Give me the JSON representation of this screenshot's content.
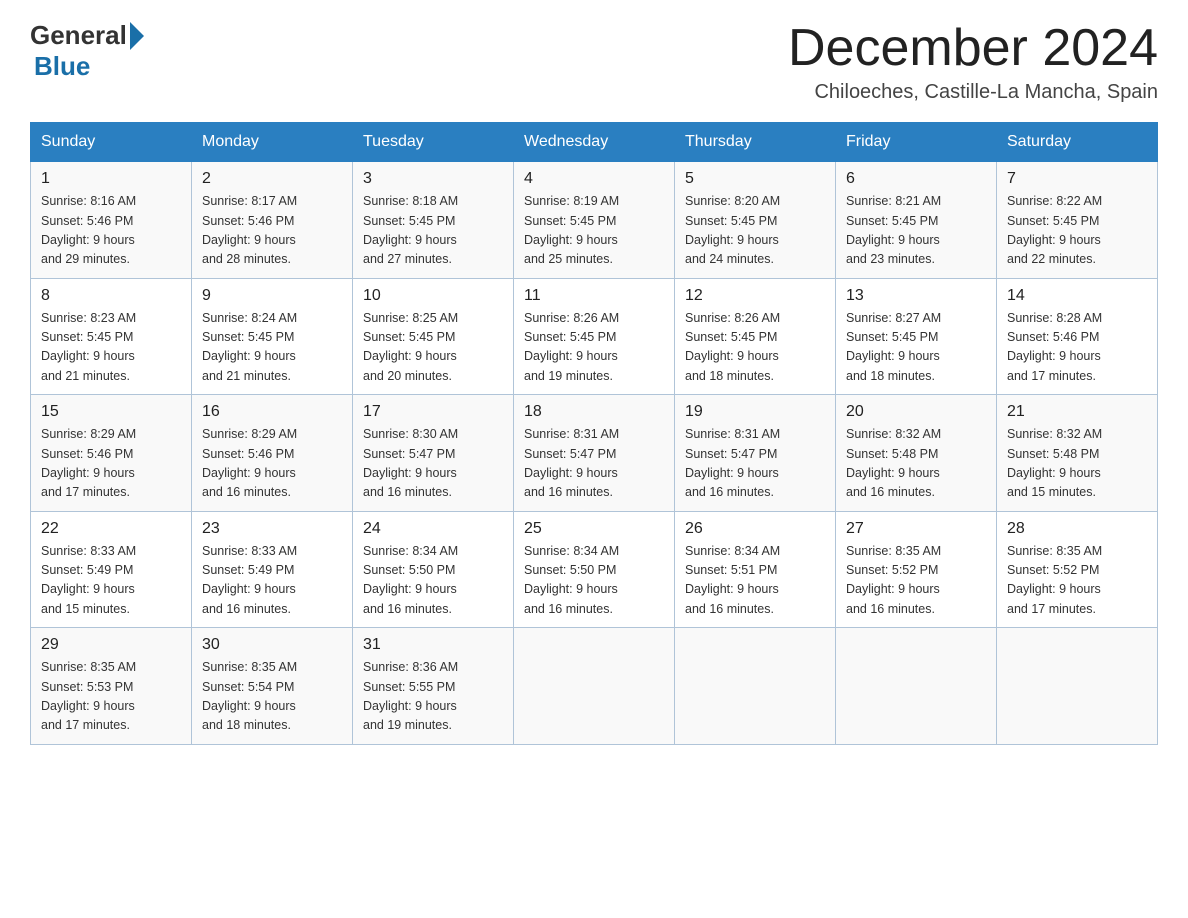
{
  "header": {
    "logo_general": "General",
    "logo_blue": "Blue",
    "month_title": "December 2024",
    "location": "Chiloeches, Castille-La Mancha, Spain"
  },
  "days_of_week": [
    "Sunday",
    "Monday",
    "Tuesday",
    "Wednesday",
    "Thursday",
    "Friday",
    "Saturday"
  ],
  "weeks": [
    [
      {
        "day": "1",
        "sunrise": "8:16 AM",
        "sunset": "5:46 PM",
        "daylight": "9 hours and 29 minutes."
      },
      {
        "day": "2",
        "sunrise": "8:17 AM",
        "sunset": "5:46 PM",
        "daylight": "9 hours and 28 minutes."
      },
      {
        "day": "3",
        "sunrise": "8:18 AM",
        "sunset": "5:45 PM",
        "daylight": "9 hours and 27 minutes."
      },
      {
        "day": "4",
        "sunrise": "8:19 AM",
        "sunset": "5:45 PM",
        "daylight": "9 hours and 25 minutes."
      },
      {
        "day": "5",
        "sunrise": "8:20 AM",
        "sunset": "5:45 PM",
        "daylight": "9 hours and 24 minutes."
      },
      {
        "day": "6",
        "sunrise": "8:21 AM",
        "sunset": "5:45 PM",
        "daylight": "9 hours and 23 minutes."
      },
      {
        "day": "7",
        "sunrise": "8:22 AM",
        "sunset": "5:45 PM",
        "daylight": "9 hours and 22 minutes."
      }
    ],
    [
      {
        "day": "8",
        "sunrise": "8:23 AM",
        "sunset": "5:45 PM",
        "daylight": "9 hours and 21 minutes."
      },
      {
        "day": "9",
        "sunrise": "8:24 AM",
        "sunset": "5:45 PM",
        "daylight": "9 hours and 21 minutes."
      },
      {
        "day": "10",
        "sunrise": "8:25 AM",
        "sunset": "5:45 PM",
        "daylight": "9 hours and 20 minutes."
      },
      {
        "day": "11",
        "sunrise": "8:26 AM",
        "sunset": "5:45 PM",
        "daylight": "9 hours and 19 minutes."
      },
      {
        "day": "12",
        "sunrise": "8:26 AM",
        "sunset": "5:45 PM",
        "daylight": "9 hours and 18 minutes."
      },
      {
        "day": "13",
        "sunrise": "8:27 AM",
        "sunset": "5:45 PM",
        "daylight": "9 hours and 18 minutes."
      },
      {
        "day": "14",
        "sunrise": "8:28 AM",
        "sunset": "5:46 PM",
        "daylight": "9 hours and 17 minutes."
      }
    ],
    [
      {
        "day": "15",
        "sunrise": "8:29 AM",
        "sunset": "5:46 PM",
        "daylight": "9 hours and 17 minutes."
      },
      {
        "day": "16",
        "sunrise": "8:29 AM",
        "sunset": "5:46 PM",
        "daylight": "9 hours and 16 minutes."
      },
      {
        "day": "17",
        "sunrise": "8:30 AM",
        "sunset": "5:47 PM",
        "daylight": "9 hours and 16 minutes."
      },
      {
        "day": "18",
        "sunrise": "8:31 AM",
        "sunset": "5:47 PM",
        "daylight": "9 hours and 16 minutes."
      },
      {
        "day": "19",
        "sunrise": "8:31 AM",
        "sunset": "5:47 PM",
        "daylight": "9 hours and 16 minutes."
      },
      {
        "day": "20",
        "sunrise": "8:32 AM",
        "sunset": "5:48 PM",
        "daylight": "9 hours and 16 minutes."
      },
      {
        "day": "21",
        "sunrise": "8:32 AM",
        "sunset": "5:48 PM",
        "daylight": "9 hours and 15 minutes."
      }
    ],
    [
      {
        "day": "22",
        "sunrise": "8:33 AM",
        "sunset": "5:49 PM",
        "daylight": "9 hours and 15 minutes."
      },
      {
        "day": "23",
        "sunrise": "8:33 AM",
        "sunset": "5:49 PM",
        "daylight": "9 hours and 16 minutes."
      },
      {
        "day": "24",
        "sunrise": "8:34 AM",
        "sunset": "5:50 PM",
        "daylight": "9 hours and 16 minutes."
      },
      {
        "day": "25",
        "sunrise": "8:34 AM",
        "sunset": "5:50 PM",
        "daylight": "9 hours and 16 minutes."
      },
      {
        "day": "26",
        "sunrise": "8:34 AM",
        "sunset": "5:51 PM",
        "daylight": "9 hours and 16 minutes."
      },
      {
        "day": "27",
        "sunrise": "8:35 AM",
        "sunset": "5:52 PM",
        "daylight": "9 hours and 16 minutes."
      },
      {
        "day": "28",
        "sunrise": "8:35 AM",
        "sunset": "5:52 PM",
        "daylight": "9 hours and 17 minutes."
      }
    ],
    [
      {
        "day": "29",
        "sunrise": "8:35 AM",
        "sunset": "5:53 PM",
        "daylight": "9 hours and 17 minutes."
      },
      {
        "day": "30",
        "sunrise": "8:35 AM",
        "sunset": "5:54 PM",
        "daylight": "9 hours and 18 minutes."
      },
      {
        "day": "31",
        "sunrise": "8:36 AM",
        "sunset": "5:55 PM",
        "daylight": "9 hours and 19 minutes."
      },
      null,
      null,
      null,
      null
    ]
  ]
}
